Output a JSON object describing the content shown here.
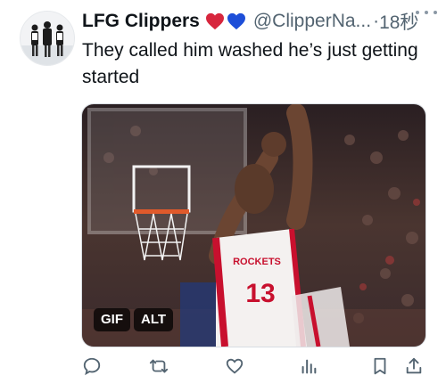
{
  "tweet": {
    "display_name": "LFG Clippers",
    "handle": "@ClipperNa...",
    "separator": "·",
    "time": "18秒",
    "text": "They called him washed he’s just getting started",
    "heart_colors": [
      "#d7263d",
      "#1d4ed8"
    ]
  },
  "media": {
    "gif_label": "GIF",
    "alt_label": "ALT",
    "jersey_text": "ROCKETS",
    "jersey_number": "13"
  },
  "actions": {
    "icons": [
      "reply-icon",
      "retweet-icon",
      "like-icon",
      "views-icon",
      "bookmark-icon",
      "share-icon"
    ]
  }
}
